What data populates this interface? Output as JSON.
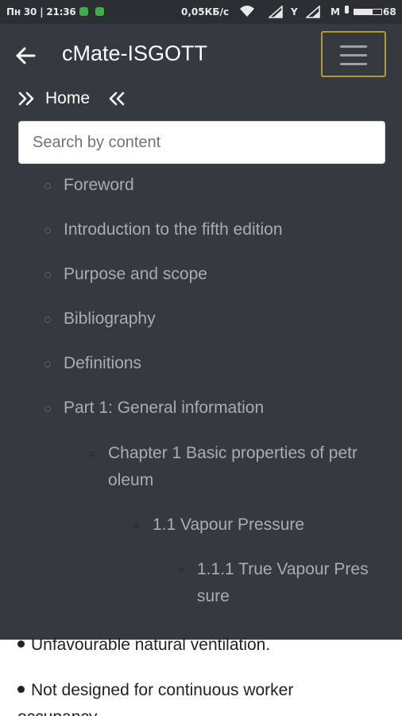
{
  "status_bar": {
    "time": "Пн 30 | 21:36",
    "network_speed": "0,05КБ/с",
    "carrier1": "Y",
    "carrier2": "M",
    "battery_level": 68,
    "battery_text": "68",
    "icons": [
      "notification-icon",
      "notification-icon",
      "wifi-icon",
      "signal-icon",
      "signal-icon",
      "battery-icon"
    ]
  },
  "header": {
    "back_icon": "arrow-left-icon",
    "title": "cMate-ISGOTT",
    "menu_icon": "hamburger-icon",
    "menu_border_color": "#b59a32"
  },
  "breadcrumb": {
    "left_icon": "double-chevron-right-icon",
    "label": "Home",
    "right_icon": "double-chevron-left-icon"
  },
  "search": {
    "placeholder": "Search by content",
    "value": ""
  },
  "toc": {
    "items": [
      {
        "level": 1,
        "text": "Foreword"
      },
      {
        "level": 1,
        "text": "Introduction to the fifth edition"
      },
      {
        "level": 1,
        "text": "Purpose and scope"
      },
      {
        "level": 1,
        "text": "Bibliography"
      },
      {
        "level": 1,
        "text": "Definitions"
      },
      {
        "level": 1,
        "text": "Part 1: General information"
      },
      {
        "level": 2,
        "line1": "Chapter 1 Basic properties of petr",
        "line2": "oleum"
      },
      {
        "level": 3,
        "text": "1.1 Vapour Pressure"
      },
      {
        "level": 4,
        "line1": "1.1.1 True Vapour Pres",
        "line2": "sure"
      }
    ]
  },
  "content": {
    "bullets": [
      "Unfavourable natural ventilation.",
      "Not designed for continuous worker",
      "occupancy."
    ]
  },
  "colors": {
    "panel_bg": "#343a40",
    "status_bg": "#2b2f33",
    "toc_text": "#a8adb2"
  }
}
